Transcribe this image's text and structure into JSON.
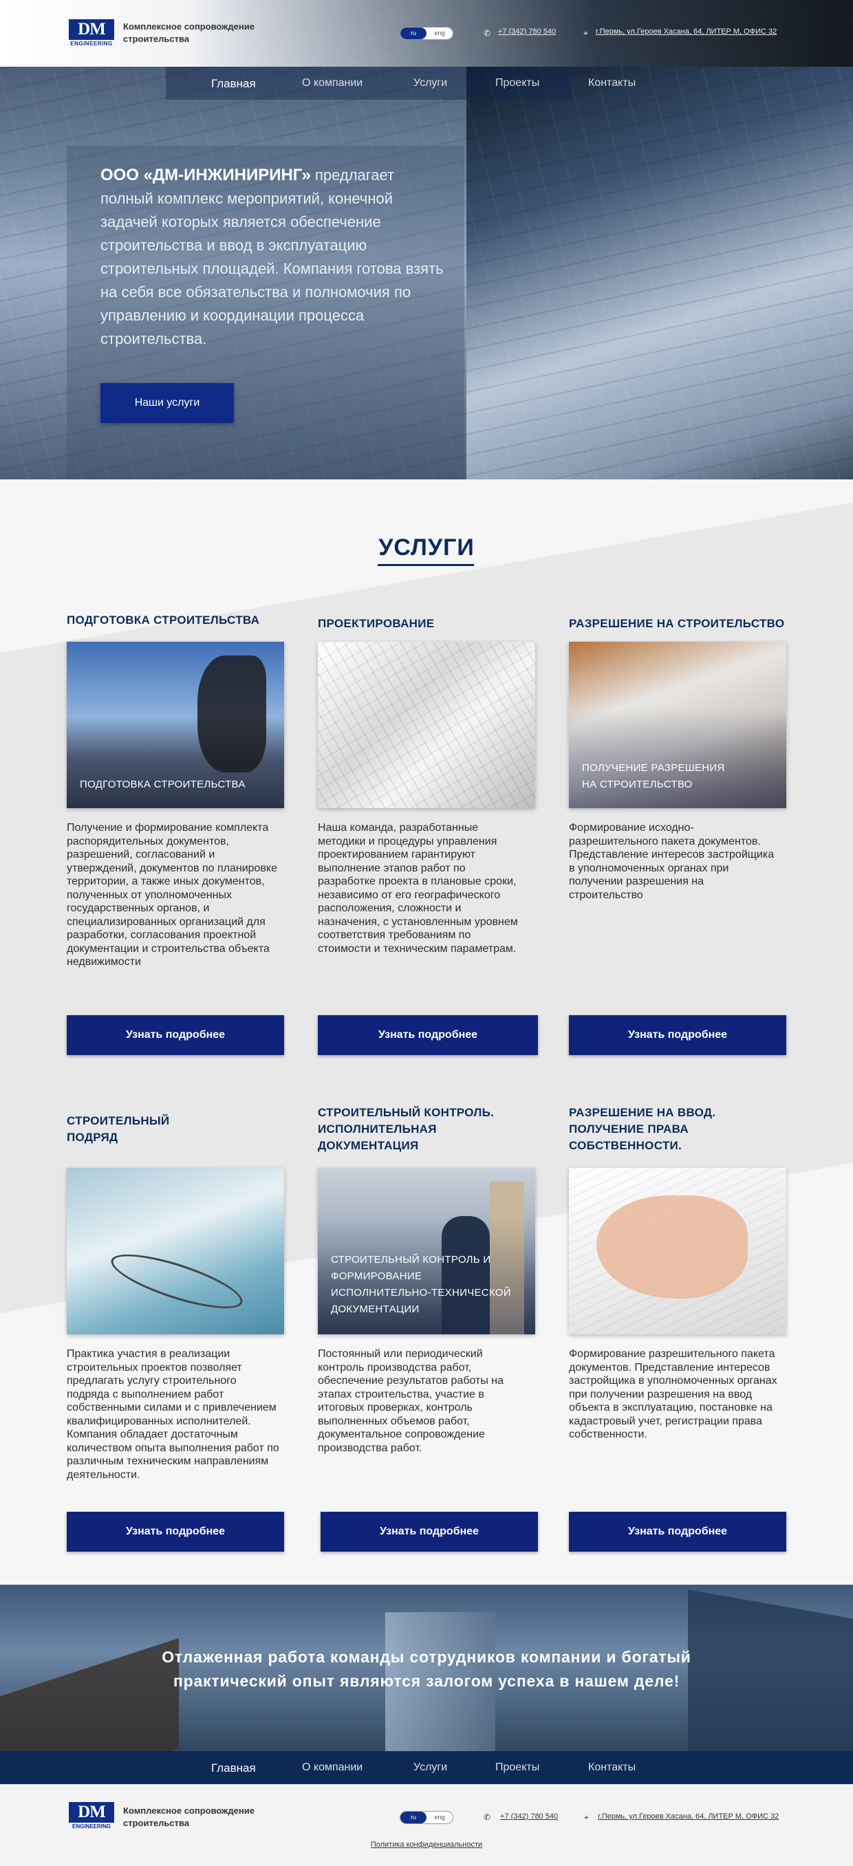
{
  "header": {
    "logo_text": "DM",
    "logo_sub": "ENGINEERING",
    "tagline": "Комплексное сопровождение строительства",
    "lang_ru": "ru",
    "lang_en": "eng",
    "phone": "+7 (342) 780 540",
    "address": "г.Пермь, ул.Героев Хасана, 64, ЛИТЕР М, ОФИС 32"
  },
  "nav": {
    "items": [
      "Главная",
      "О компании",
      "Услуги",
      "Проекты",
      "Контакты"
    ]
  },
  "hero": {
    "company": "ООО «ДМ-ИНЖИНИРИНГ»",
    "text": " предлагает полный комплекс мероприятий, конечной задачей которых является обеспечение строительства и ввод в эксплуатацию строительных площадей. Компания готова взять на себя все обязательства и полномочия по управлению и координации процесса строительства.",
    "button": "Наши услуги"
  },
  "services": {
    "title": "УСЛУГИ",
    "button_label": "Узнать подробнее",
    "cards": [
      {
        "title": "ПОДГОТОВКА СТРОИТЕЛЬСТВА",
        "caption": "ПОДГОТОВКА СТРОИТЕЛЬСТВА",
        "text": "Получение и формирование комплекта распорядительных документов, разрешений, согласований и утверждений, документов по планировке территории, а также иных документов, полученных от уполномоченных государственных органов, и специализированных организаций для разработки, согласования проектной документации и строительства объекта недвижимости"
      },
      {
        "title": "ПРОЕКТИРОВАНИЕ",
        "caption": "",
        "text": "Наша команда, разработанные методики и процедуры управления проектированием гарантируют выполнение этапов работ по разработке проекта в плановые сроки, независимо от его географического расположения, сложности и назначения, с установленным уровнем соответствия требованиям по стоимости и техническим параметрам."
      },
      {
        "title": "РАЗРЕШЕНИЕ НА СТРОИТЕЛЬСТВО",
        "caption": "ПОЛУЧЕНИЕ РАЗРЕШЕНИЯ НА СТРОИТЕЛЬСТВО",
        "text": "Формирование исходно-разрешительного пакета документов. Представление интересов застройщика в уполномоченных органах при получении разрешения на строительство"
      },
      {
        "title": "СТРОИТЕЛЬНЫЙ ПОДРЯД",
        "caption": "",
        "text": "Практика участия в реализации строительных проектов позволяет предлагать услугу строительного подряда с выполнением работ собственными силами и с привлечением квалифицированных исполнителей. Компания обладает достаточным количеством опыта выполнения работ по различным техническим направлениям деятельности."
      },
      {
        "title": "СТРОИТЕЛЬНЫЙ КОНТРОЛЬ. ИСПОЛНИТЕЛЬНАЯ ДОКУМЕНТАЦИЯ",
        "caption": "СТРОИТЕЛЬНЫЙ КОНТРОЛЬ И ФОРМИРОВАНИЕ ИСПОЛНИТЕЛЬНО-ТЕХНИЧЕСКОЙ ДОКУМЕНТАЦИИ",
        "text": "Постоянный или периодический контроль производства работ, обеспечение результатов работы на этапах строительства, участие в итоговых проверках, контроль выполненных объемов работ, документальное сопровождение производства работ."
      },
      {
        "title": "РАЗРЕШЕНИЕ НА ВВОД. ПОЛУЧЕНИЕ ПРАВА СОБСТВЕННОСТИ.",
        "caption": "",
        "text": "Формирование разрешительного пакета документов. Представление интересов застройщика в уполномоченных органах при получении разрешения на ввод объекта в эксплуатацию, постановке на кадастровый учет, регистрации права собственности."
      }
    ]
  },
  "banner": {
    "text": "Отлаженная работа команды сотрудников компании и богатый практический опыт являются залогом успеха в нашем деле!"
  },
  "footer": {
    "policy": "Политика конфиденциальности"
  },
  "colors": {
    "brand": "#0f2e87",
    "button": "#0f237a",
    "heading": "#0c2a5b",
    "footer_nav": "#0d2a57"
  }
}
